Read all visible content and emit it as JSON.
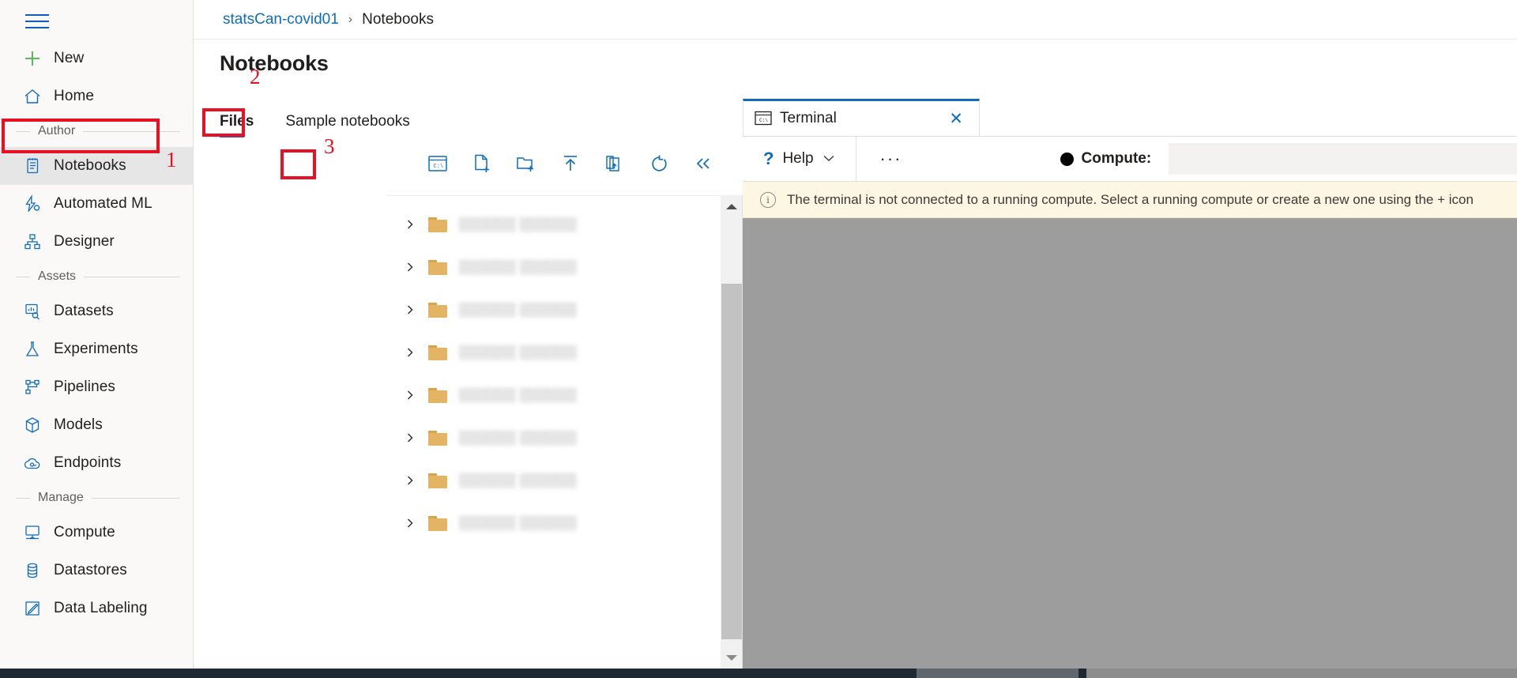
{
  "sidebar": {
    "menu_icon": "hamburger-icon",
    "top_items": [
      {
        "label": "New",
        "icon": "plus-icon"
      },
      {
        "label": "Home",
        "icon": "home-icon"
      }
    ],
    "groups": [
      {
        "title": "Author",
        "items": [
          {
            "label": "Notebooks",
            "icon": "notebook-icon",
            "selected": true
          },
          {
            "label": "Automated ML",
            "icon": "automated-ml-icon",
            "selected": false
          },
          {
            "label": "Designer",
            "icon": "designer-icon",
            "selected": false
          }
        ]
      },
      {
        "title": "Assets",
        "items": [
          {
            "label": "Datasets",
            "icon": "datasets-icon",
            "selected": false
          },
          {
            "label": "Experiments",
            "icon": "experiments-flask-icon",
            "selected": false
          },
          {
            "label": "Pipelines",
            "icon": "pipelines-icon",
            "selected": false
          },
          {
            "label": "Models",
            "icon": "models-cube-icon",
            "selected": false
          },
          {
            "label": "Endpoints",
            "icon": "endpoints-cloud-icon",
            "selected": false
          }
        ]
      },
      {
        "title": "Manage",
        "items": [
          {
            "label": "Compute",
            "icon": "compute-monitor-icon",
            "selected": false
          },
          {
            "label": "Datastores",
            "icon": "datastores-database-icon",
            "selected": false
          },
          {
            "label": "Data Labeling",
            "icon": "data-labeling-pencil-icon",
            "selected": false
          }
        ]
      }
    ]
  },
  "breadcrumb": {
    "workspace": "statsCan-covid01",
    "separator": "›",
    "current": "Notebooks"
  },
  "page": {
    "title": "Notebooks"
  },
  "tabs": [
    {
      "label": "Files",
      "active": true
    },
    {
      "label": "Sample notebooks",
      "active": false
    }
  ],
  "file_toolbar": [
    {
      "name": "open-terminal-icon",
      "title": "Open terminal"
    },
    {
      "name": "create-new-file-icon",
      "title": "Create new file"
    },
    {
      "name": "create-new-folder-icon",
      "title": "Create new folder"
    },
    {
      "name": "upload-files-icon",
      "title": "Upload files"
    },
    {
      "name": "upload-folder-icon",
      "title": "Upload folder"
    },
    {
      "name": "refresh-icon",
      "title": "Refresh"
    },
    {
      "name": "collapse-icon",
      "title": "Collapse"
    }
  ],
  "file_tree": {
    "rows": [
      {
        "name": "░░░░░░ ░░░░░░",
        "redacted": true
      },
      {
        "name": "░░░░░░ ░░░░░░",
        "redacted": true
      },
      {
        "name": "░░░░░░ ░░░░░░",
        "redacted": true
      },
      {
        "name": "░░░░░░ ░░░░░░",
        "redacted": true
      },
      {
        "name": "░░░░░░ ░░░░░░",
        "redacted": true
      },
      {
        "name": "░░░░░░ ░░░░░░",
        "redacted": true
      },
      {
        "name": "░░░░░░ ░░░░░░",
        "redacted": true
      },
      {
        "name": "░░░░░░ ░░░░░░",
        "redacted": true
      }
    ]
  },
  "terminal": {
    "tab_label": "Terminal",
    "tab_icon": "console-icon",
    "close_label": "✕",
    "help_label": "Help",
    "help_icon": "question-mark-icon",
    "more_label": "···",
    "compute_label": "Compute:",
    "compute_value": "",
    "compute_placeholder": "",
    "chevron": "∨",
    "run_icon": "play-triangle-icon",
    "add_icon": "plus-icon",
    "warning": "The terminal is not connected to a running compute. Select a running compute or create a new one using the + icon",
    "warning_icon": "info-circle-icon"
  },
  "annotations": [
    {
      "number": "1",
      "target": "notebooks-sidebar-item"
    },
    {
      "number": "2",
      "target": "files-tab"
    },
    {
      "number": "3",
      "target": "open-terminal-button"
    }
  ],
  "colors": {
    "accent": "#0f6cbd",
    "annotation_red": "#e81123",
    "warning_bg": "#fdf6e3",
    "terminal_bg": "#9d9d9d",
    "sidebar_bg": "#faf9f8",
    "selected_bg": "#e6e6e6"
  }
}
